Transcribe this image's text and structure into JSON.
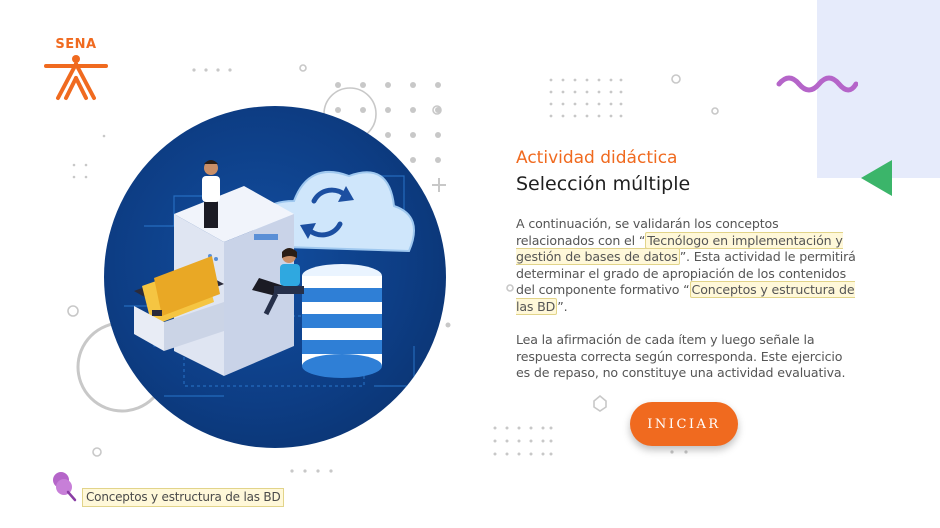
{
  "logo": {
    "text": "SENA"
  },
  "activity": {
    "eyebrow": "Actividad didáctica",
    "title": "Selección múltiple"
  },
  "intro": {
    "part1": "A continuación, se validarán los conceptos relacionados con el “",
    "highlight1": "Tecnólogo en implementación y gestión de bases de datos",
    "part2": "”.  Esta actividad le permitirá determinar el grado de apropiación de los contenidos del componente formativo “",
    "highlight2": "Conceptos y estructura de las  BD",
    "part3": "”."
  },
  "instructions": "Lea la afirmación de cada ítem y luego señale la respuesta correcta según corresponda.  Este ejercicio es de repaso, no constituye una actividad evaluativa.",
  "start_button": {
    "label": "INICIAR"
  },
  "footer": {
    "tag": "Conceptos y estructura de las  BD"
  },
  "colors": {
    "accent": "#f06a1f",
    "hero_bg": "#0d3d84",
    "tag_bg": "#fff8d9",
    "squiggle": "#b565c9",
    "triangle": "#3bb56a",
    "panel": "#e6ebfb"
  },
  "icons": [
    "sena-logo-icon",
    "sync-icon",
    "pin-icon",
    "database-icon",
    "file-cabinet-icon"
  ]
}
